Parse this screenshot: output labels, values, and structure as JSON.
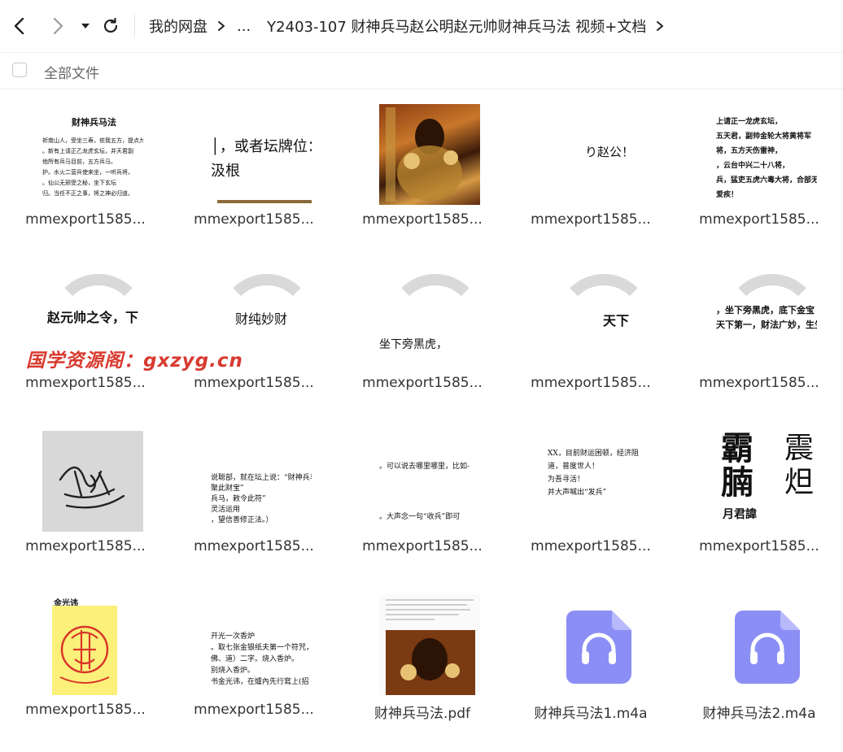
{
  "header": {
    "breadcrumb_root": "我的网盘",
    "breadcrumb_ellipsis": "...",
    "breadcrumb_current": "Y2403-107 财神兵马赵公明赵元帅财神兵马法 视频+文档"
  },
  "toolbar": {
    "all_files_label": "全部文件"
  },
  "watermark_text": "国学资源阁：gxzyg.cn",
  "files": [
    {
      "name": "mmexport1585...",
      "thumb_title": "财神兵马法",
      "thumb_lines": [
        "祈南山人，受坐三寿，依我五方，提点九州，",
        "。新有上请正乙龙虎玄坛，并天君副",
        "他所有兵马目前，五方兵马。",
        "护。水火二营兵使来坐，一听兵将，",
        "。仙公无邪受之秘，坐下玄坛",
        "归。当任不正之事，将之神必归道。"
      ]
    },
    {
      "name": "mmexport1585...",
      "thumb_lines": [
        "│，或者坛牌位：",
        "汲根"
      ]
    },
    {
      "name": "mmexport1585...",
      "thumb_kind": "statue"
    },
    {
      "name": "mmexport1585...",
      "thumb_lines": [
        "り赵公！"
      ]
    },
    {
      "name": "mmexport1585...",
      "thumb_lines": [
        "上请正一龙虎玄坛，",
        "五天君，副帅金轮大将黄将军",
        "将，五方天伤雷神，",
        "，云台中兴二十八将，",
        "兵，猛吏五虎六毒大将，合部无",
        "爱疾！"
      ]
    },
    {
      "name": "mmexport1585...",
      "thumb_lines": [
        "赵元帅之令，下"
      ]
    },
    {
      "name": "mmexport1585...",
      "thumb_lines": [
        "财纯妙财"
      ]
    },
    {
      "name": "mmexport1585...",
      "thumb_lines": [
        "坐下旁黑虎，"
      ]
    },
    {
      "name": "mmexport1585...",
      "thumb_lines": [
        "天下"
      ]
    },
    {
      "name": "mmexport1585...",
      "thumb_lines": [
        "，坐下旁黑虎，底下金宝",
        "天下第一，财法广妙，生生"
      ]
    },
    {
      "name": "mmexport1585...",
      "thumb_kind": "signature"
    },
    {
      "name": "mmexport1585...",
      "thumb_lines": [
        "说聪部，就在坛上说：“财神兵马",
        "聚此财宝”",
        "兵马，敕令此符”",
        "灵活运用",
        "，望信善修正法。）"
      ]
    },
    {
      "name": "mmexport1585...",
      "thumb_lines": [
        "。可以说去哪里哪里，比如-",
        "。大声念一句“收兵”即可"
      ]
    },
    {
      "name": "mmexport1585...",
      "thumb_lines": [
        "XX，目前财运困顿，经济阻",
        "道，普度世人！",
        "为吾寻活！",
        "并大声喊出“发兵”"
      ]
    },
    {
      "name": "mmexport1585...",
      "thumb_kind": "calligraphy",
      "thumb_lines": [
        "霸",
        "腩",
        "月君諱",
        "震",
        "炟"
      ]
    },
    {
      "name": "mmexport1585...",
      "thumb_kind": "seal",
      "thumb_lines": [
        "金光讳"
      ]
    },
    {
      "name": "mmexport1585...",
      "thumb_lines": [
        "开光一次香炉",
        "。取七张金银纸夫第一个符咒，",
        "佛、道）二字。烧入香炉。",
        "别烧入香炉。",
        "书金光讳，在爐內先行寫上(招"
      ]
    },
    {
      "name": "财神兵马法.pdf",
      "thumb_kind": "pdf"
    },
    {
      "name": "财神兵马法1.m4a",
      "thumb_kind": "audio"
    },
    {
      "name": "财神兵马法2.m4a",
      "thumb_kind": "audio"
    }
  ],
  "colors": {
    "audio_icon": "#8b8ef5",
    "pdf_badge": "#f25b5b",
    "watermark": "#d83a2f"
  },
  "icons": [
    "back-icon",
    "forward-icon",
    "dropdown-icon",
    "refresh-icon",
    "chevron-right-icon",
    "headphones-icon",
    "pdf-icon"
  ]
}
